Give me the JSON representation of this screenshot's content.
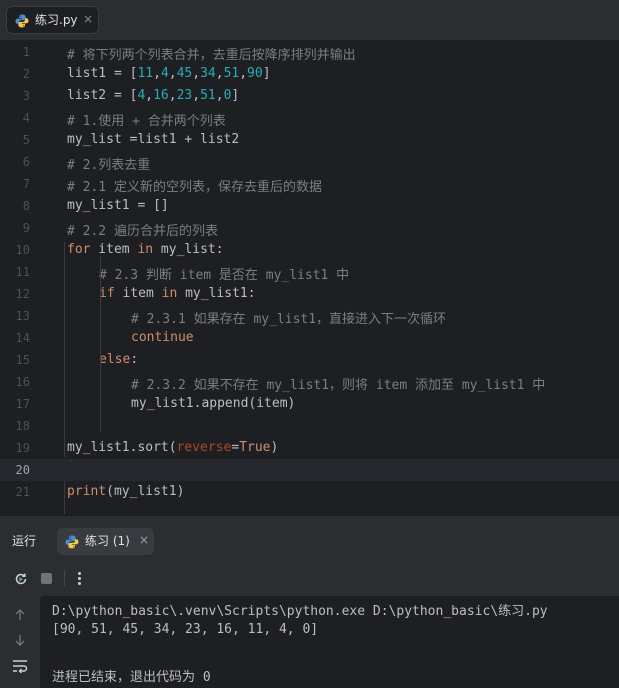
{
  "editor_tab": {
    "filename": "练习.py",
    "close_glyph": "×",
    "icon": "python-icon"
  },
  "code_lines": [
    {
      "n": "1",
      "indent": 0,
      "tokens": [
        {
          "t": "# 将下列两个列表合并，去重后按降序排列并输出",
          "c": "cmt"
        }
      ]
    },
    {
      "n": "2",
      "indent": 0,
      "tokens": [
        {
          "t": "list1 = [",
          "c": ""
        },
        {
          "t": "11",
          "c": "num"
        },
        {
          "t": ",",
          "c": ""
        },
        {
          "t": "4",
          "c": "num"
        },
        {
          "t": ",",
          "c": ""
        },
        {
          "t": "45",
          "c": "num"
        },
        {
          "t": ",",
          "c": ""
        },
        {
          "t": "34",
          "c": "num"
        },
        {
          "t": ",",
          "c": ""
        },
        {
          "t": "51",
          "c": "num"
        },
        {
          "t": ",",
          "c": ""
        },
        {
          "t": "90",
          "c": "num"
        },
        {
          "t": "]",
          "c": ""
        }
      ]
    },
    {
      "n": "3",
      "indent": 0,
      "tokens": [
        {
          "t": "list2 = [",
          "c": ""
        },
        {
          "t": "4",
          "c": "num"
        },
        {
          "t": ",",
          "c": ""
        },
        {
          "t": "16",
          "c": "num"
        },
        {
          "t": ",",
          "c": ""
        },
        {
          "t": "23",
          "c": "num"
        },
        {
          "t": ",",
          "c": ""
        },
        {
          "t": "51",
          "c": "num"
        },
        {
          "t": ",",
          "c": ""
        },
        {
          "t": "0",
          "c": "num"
        },
        {
          "t": "]",
          "c": ""
        }
      ]
    },
    {
      "n": "4",
      "indent": 0,
      "tokens": [
        {
          "t": "# 1.使用 + 合并两个列表",
          "c": "cmt"
        }
      ]
    },
    {
      "n": "5",
      "indent": 0,
      "tokens": [
        {
          "t": "my_list =list1 + list2",
          "c": ""
        }
      ]
    },
    {
      "n": "6",
      "indent": 0,
      "tokens": [
        {
          "t": "# 2.列表去重",
          "c": "cmt"
        }
      ]
    },
    {
      "n": "7",
      "indent": 0,
      "tokens": [
        {
          "t": "# 2.1 定义新的空列表，保存去重后的数据",
          "c": "cmt"
        }
      ]
    },
    {
      "n": "8",
      "indent": 0,
      "tokens": [
        {
          "t": "my_list1 = []",
          "c": ""
        }
      ]
    },
    {
      "n": "9",
      "indent": 0,
      "tokens": [
        {
          "t": "# 2.2 遍历合并后的列表",
          "c": "cmt"
        }
      ]
    },
    {
      "n": "10",
      "indent": 0,
      "tokens": [
        {
          "t": "for",
          "c": "kw"
        },
        {
          "t": " item ",
          "c": ""
        },
        {
          "t": "in",
          "c": "kw"
        },
        {
          "t": " my_list:",
          "c": ""
        }
      ]
    },
    {
      "n": "11",
      "indent": 1,
      "tokens": [
        {
          "t": "# 2.3 判断 item 是否在 my_list1 中",
          "c": "cmt"
        }
      ]
    },
    {
      "n": "12",
      "indent": 1,
      "tokens": [
        {
          "t": "if",
          "c": "kw"
        },
        {
          "t": " item ",
          "c": ""
        },
        {
          "t": "in",
          "c": "kw"
        },
        {
          "t": " my_list1:",
          "c": ""
        }
      ]
    },
    {
      "n": "13",
      "indent": 2,
      "tokens": [
        {
          "t": "# 2.3.1 如果存在 my_list1，直接进入下一次循环",
          "c": "cmt"
        }
      ]
    },
    {
      "n": "14",
      "indent": 2,
      "tokens": [
        {
          "t": "continue",
          "c": "kw"
        }
      ]
    },
    {
      "n": "15",
      "indent": 1,
      "tokens": [
        {
          "t": "else",
          "c": "kw"
        },
        {
          "t": ":",
          "c": ""
        }
      ]
    },
    {
      "n": "16",
      "indent": 2,
      "tokens": [
        {
          "t": "# 2.3.2 如果不存在 my_list1，则将 item 添加至 my_list1 中",
          "c": "cmt"
        }
      ]
    },
    {
      "n": "17",
      "indent": 2,
      "tokens": [
        {
          "t": "my_list1.append(item)",
          "c": ""
        }
      ]
    },
    {
      "n": "18",
      "indent": 0,
      "tokens": []
    },
    {
      "n": "19",
      "indent": 0,
      "tokens": [
        {
          "t": "my_list1.sort(",
          "c": ""
        },
        {
          "t": "reverse",
          "c": "param"
        },
        {
          "t": "=",
          "c": ""
        },
        {
          "t": "True",
          "c": "kw"
        },
        {
          "t": ")",
          "c": ""
        }
      ]
    },
    {
      "n": "20",
      "indent": 0,
      "tokens": []
    },
    {
      "n": "21",
      "indent": 0,
      "tokens": [
        {
          "t": "print",
          "c": "kw"
        },
        {
          "t": "(my_list1)",
          "c": ""
        }
      ]
    }
  ],
  "current_line": "20",
  "run_panel": {
    "label": "运行",
    "tab_label": "练习 (1)",
    "tab_close": "×",
    "toolbar": {
      "rerun_icon": "rerun-icon",
      "stop_icon": "stop-icon",
      "more_icon": "more-vertical-icon"
    },
    "side_icons": [
      "up-arrow-icon",
      "down-arrow-icon",
      "soft-wrap-icon"
    ]
  },
  "console": {
    "lines": [
      "D:\\python_basic\\.venv\\Scripts\\python.exe D:\\python_basic\\练习.py",
      "[90, 51, 45, 34, 23, 16, 11, 4, 0]",
      "",
      "进程已结束，退出代码为 0"
    ]
  },
  "colors": {
    "keyword": "#cf8e6d",
    "number": "#2aacb8",
    "comment": "#7a7e85",
    "param": "#aa4926",
    "text": "#bcbec4",
    "editor_bg": "#1e1f22",
    "panel_bg": "#2b2d30"
  }
}
